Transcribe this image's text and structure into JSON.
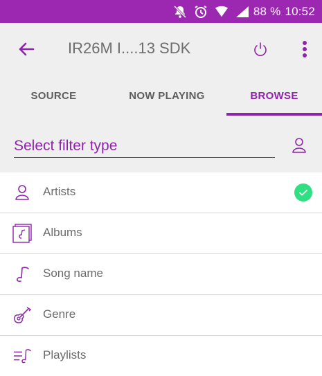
{
  "status_bar": {
    "battery": "88 %",
    "time": "10:52"
  },
  "toolbar": {
    "title": "IR26M I....13 SDK"
  },
  "tabs": [
    {
      "label": "SOURCE",
      "active": false
    },
    {
      "label": "NOW PLAYING",
      "active": false
    },
    {
      "label": "BROWSE",
      "active": true
    }
  ],
  "filter": {
    "label": "Select filter type"
  },
  "list": {
    "items": [
      {
        "label": "Artists",
        "icon": "person-icon",
        "selected": true
      },
      {
        "label": "Albums",
        "icon": "album-icon",
        "selected": false
      },
      {
        "label": "Song name",
        "icon": "music-note-icon",
        "selected": false
      },
      {
        "label": "Genre",
        "icon": "guitar-icon",
        "selected": false
      },
      {
        "label": "Playlists",
        "icon": "playlist-icon",
        "selected": false
      }
    ]
  },
  "colors": {
    "accent": "#8e24aa",
    "status_bar": "#9c27b0",
    "check": "#2ee081",
    "toolbar_bg": "#efefef"
  }
}
